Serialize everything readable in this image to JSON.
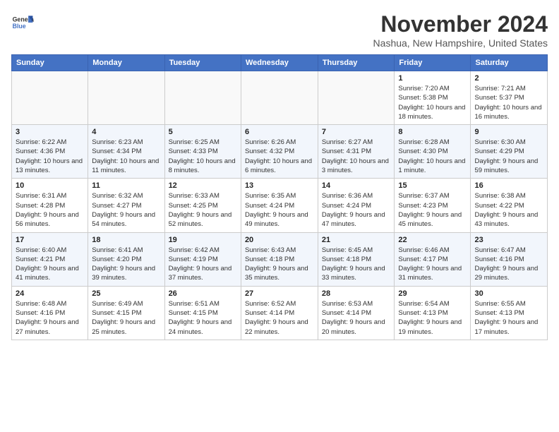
{
  "header": {
    "logo_line1": "General",
    "logo_line2": "Blue",
    "month_title": "November 2024",
    "location": "Nashua, New Hampshire, United States"
  },
  "days_of_week": [
    "Sunday",
    "Monday",
    "Tuesday",
    "Wednesday",
    "Thursday",
    "Friday",
    "Saturday"
  ],
  "weeks": [
    [
      {
        "day": "",
        "info": ""
      },
      {
        "day": "",
        "info": ""
      },
      {
        "day": "",
        "info": ""
      },
      {
        "day": "",
        "info": ""
      },
      {
        "day": "",
        "info": ""
      },
      {
        "day": "1",
        "info": "Sunrise: 7:20 AM\nSunset: 5:38 PM\nDaylight: 10 hours and 18 minutes."
      },
      {
        "day": "2",
        "info": "Sunrise: 7:21 AM\nSunset: 5:37 PM\nDaylight: 10 hours and 16 minutes."
      }
    ],
    [
      {
        "day": "3",
        "info": "Sunrise: 6:22 AM\nSunset: 4:36 PM\nDaylight: 10 hours and 13 minutes."
      },
      {
        "day": "4",
        "info": "Sunrise: 6:23 AM\nSunset: 4:34 PM\nDaylight: 10 hours and 11 minutes."
      },
      {
        "day": "5",
        "info": "Sunrise: 6:25 AM\nSunset: 4:33 PM\nDaylight: 10 hours and 8 minutes."
      },
      {
        "day": "6",
        "info": "Sunrise: 6:26 AM\nSunset: 4:32 PM\nDaylight: 10 hours and 6 minutes."
      },
      {
        "day": "7",
        "info": "Sunrise: 6:27 AM\nSunset: 4:31 PM\nDaylight: 10 hours and 3 minutes."
      },
      {
        "day": "8",
        "info": "Sunrise: 6:28 AM\nSunset: 4:30 PM\nDaylight: 10 hours and 1 minute."
      },
      {
        "day": "9",
        "info": "Sunrise: 6:30 AM\nSunset: 4:29 PM\nDaylight: 9 hours and 59 minutes."
      }
    ],
    [
      {
        "day": "10",
        "info": "Sunrise: 6:31 AM\nSunset: 4:28 PM\nDaylight: 9 hours and 56 minutes."
      },
      {
        "day": "11",
        "info": "Sunrise: 6:32 AM\nSunset: 4:27 PM\nDaylight: 9 hours and 54 minutes."
      },
      {
        "day": "12",
        "info": "Sunrise: 6:33 AM\nSunset: 4:25 PM\nDaylight: 9 hours and 52 minutes."
      },
      {
        "day": "13",
        "info": "Sunrise: 6:35 AM\nSunset: 4:24 PM\nDaylight: 9 hours and 49 minutes."
      },
      {
        "day": "14",
        "info": "Sunrise: 6:36 AM\nSunset: 4:24 PM\nDaylight: 9 hours and 47 minutes."
      },
      {
        "day": "15",
        "info": "Sunrise: 6:37 AM\nSunset: 4:23 PM\nDaylight: 9 hours and 45 minutes."
      },
      {
        "day": "16",
        "info": "Sunrise: 6:38 AM\nSunset: 4:22 PM\nDaylight: 9 hours and 43 minutes."
      }
    ],
    [
      {
        "day": "17",
        "info": "Sunrise: 6:40 AM\nSunset: 4:21 PM\nDaylight: 9 hours and 41 minutes."
      },
      {
        "day": "18",
        "info": "Sunrise: 6:41 AM\nSunset: 4:20 PM\nDaylight: 9 hours and 39 minutes."
      },
      {
        "day": "19",
        "info": "Sunrise: 6:42 AM\nSunset: 4:19 PM\nDaylight: 9 hours and 37 minutes."
      },
      {
        "day": "20",
        "info": "Sunrise: 6:43 AM\nSunset: 4:18 PM\nDaylight: 9 hours and 35 minutes."
      },
      {
        "day": "21",
        "info": "Sunrise: 6:45 AM\nSunset: 4:18 PM\nDaylight: 9 hours and 33 minutes."
      },
      {
        "day": "22",
        "info": "Sunrise: 6:46 AM\nSunset: 4:17 PM\nDaylight: 9 hours and 31 minutes."
      },
      {
        "day": "23",
        "info": "Sunrise: 6:47 AM\nSunset: 4:16 PM\nDaylight: 9 hours and 29 minutes."
      }
    ],
    [
      {
        "day": "24",
        "info": "Sunrise: 6:48 AM\nSunset: 4:16 PM\nDaylight: 9 hours and 27 minutes."
      },
      {
        "day": "25",
        "info": "Sunrise: 6:49 AM\nSunset: 4:15 PM\nDaylight: 9 hours and 25 minutes."
      },
      {
        "day": "26",
        "info": "Sunrise: 6:51 AM\nSunset: 4:15 PM\nDaylight: 9 hours and 24 minutes."
      },
      {
        "day": "27",
        "info": "Sunrise: 6:52 AM\nSunset: 4:14 PM\nDaylight: 9 hours and 22 minutes."
      },
      {
        "day": "28",
        "info": "Sunrise: 6:53 AM\nSunset: 4:14 PM\nDaylight: 9 hours and 20 minutes."
      },
      {
        "day": "29",
        "info": "Sunrise: 6:54 AM\nSunset: 4:13 PM\nDaylight: 9 hours and 19 minutes."
      },
      {
        "day": "30",
        "info": "Sunrise: 6:55 AM\nSunset: 4:13 PM\nDaylight: 9 hours and 17 minutes."
      }
    ]
  ]
}
